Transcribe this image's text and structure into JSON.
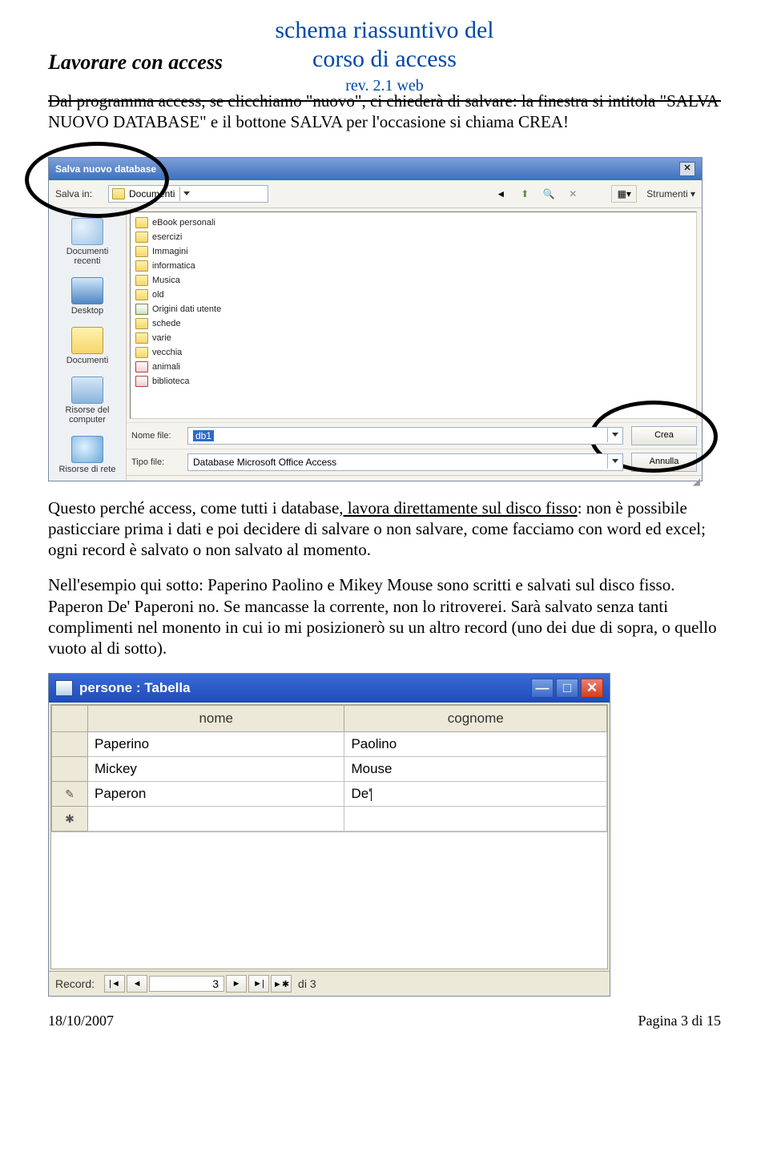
{
  "header": {
    "title_line1": "schema riassuntivo del",
    "title_line2": "corso di access",
    "rev": "rev. 2.1 web"
  },
  "section_title": "Lavorare con access",
  "para1": "Dal programma access, se clicchiamo \"nuovo\", ci chiederà di salvare: la finestra si intitola \"SALVA NUOVO DATABASE\" e il bottone SALVA per l'occasione si chiama CREA!",
  "dialog": {
    "title": "Salva nuovo database",
    "save_in_label": "Salva in:",
    "save_in_value": "Documenti",
    "tools_label": "Strumenti",
    "places": {
      "recent": "Documenti recenti",
      "desktop": "Desktop",
      "documents": "Documenti",
      "computer": "Risorse del computer",
      "network": "Risorse di rete"
    },
    "files": [
      {
        "type": "folder",
        "name": "eBook personali"
      },
      {
        "type": "folder",
        "name": "esercizi"
      },
      {
        "type": "folder",
        "name": "Immagini"
      },
      {
        "type": "folder",
        "name": "informatica"
      },
      {
        "type": "folder",
        "name": "Musica"
      },
      {
        "type": "folder",
        "name": "old"
      },
      {
        "type": "dsn",
        "name": "Origini dati utente"
      },
      {
        "type": "folder",
        "name": "schede"
      },
      {
        "type": "folder",
        "name": "varie"
      },
      {
        "type": "folder",
        "name": "vecchia"
      },
      {
        "type": "db",
        "name": "animali"
      },
      {
        "type": "db",
        "name": "biblioteca"
      }
    ],
    "filename_label": "Nome file:",
    "filename_value": "db1",
    "filetype_label": "Tipo file:",
    "filetype_value": "Database Microsoft Office Access",
    "create_btn": "Crea",
    "cancel_btn": "Annulla"
  },
  "para2_a": "Questo perché access, come tutti i database",
  "para2_b": ", lavora direttamente sul disco fisso",
  "para2_c": ": non è possibile pasticciare prima i dati e poi decidere di salvare o non salvare, come facciamo con word ed excel; ogni record è salvato o non salvato al momento.",
  "para3": "Nell'esempio qui sotto: Paperino Paolino e Mikey Mouse sono scritti e salvati sul disco fisso. Paperon De' Paperoni no. Se mancasse la corrente, non lo ritroverei. Sarà salvato senza tanti complimenti nel monento in cui io mi posizionerò su un altro record (uno dei due di sopra, o quello vuoto al di sotto).",
  "table_window": {
    "title": "persone : Tabella",
    "columns": [
      "nome",
      "cognome"
    ],
    "rows": [
      {
        "marker": "",
        "nome": "Paperino",
        "cognome": "Paolino"
      },
      {
        "marker": "",
        "nome": "Mickey",
        "cognome": "Mouse"
      },
      {
        "marker": "pencil",
        "nome": "Paperon",
        "cognome": "De'"
      },
      {
        "marker": "star",
        "nome": "",
        "cognome": ""
      }
    ],
    "record_label": "Record:",
    "record_current": "3",
    "record_of": "di 3"
  },
  "footer": {
    "date": "18/10/2007",
    "page": "Pagina 3 di 15"
  }
}
